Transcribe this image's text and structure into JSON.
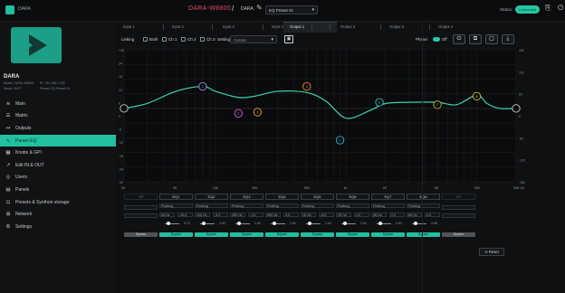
{
  "topbar": {
    "app_name": "DARA",
    "device_title": "DARA-W8800",
    "device_sub": "DARA",
    "preset": "EQ Preset Gr",
    "status_label": "Status:",
    "status_value": "Connected"
  },
  "sidebar": {
    "device_name": "DARA",
    "meta": [
      "Model: DARA-W8800",
      "IP: 192.168.1.100",
      "Serial: 00:F7",
      "Preset: EQ Preset Gr"
    ],
    "items": [
      {
        "icon": "≋",
        "label": "Main"
      },
      {
        "icon": "☰",
        "label": "Matrix"
      },
      {
        "icon": "↦",
        "label": "Outputs"
      },
      {
        "icon": "∿",
        "label": "Param EQ"
      },
      {
        "icon": "▦",
        "label": "Knobs & GPI"
      },
      {
        "icon": "↗",
        "label": "Edit IN & OUT"
      },
      {
        "icon": "◎",
        "label": "Users"
      },
      {
        "icon": "▤",
        "label": "Panels"
      },
      {
        "icon": "⊡",
        "label": "Presets & Synthon storage"
      },
      {
        "icon": "⊞",
        "label": "Network"
      },
      {
        "icon": "⚙",
        "label": "Settings"
      }
    ],
    "active_index": 3
  },
  "tabs": [
    "Input 1",
    "Input 2",
    "Input 3",
    "Input 4",
    "Output 1",
    "Output 2",
    "Output 3",
    "Output 4"
  ],
  "active_tab": 4,
  "toolbar": {
    "linking": "Linking",
    "boxes": [
      "Both",
      "Ch 1",
      "Ch 2",
      "Ch 3"
    ],
    "settings": "Settings",
    "settings_value": "Custom",
    "phase": "Phase:",
    "phase_off": "Off"
  },
  "graph": {
    "y_left": [
      "+18",
      "24",
      "18",
      "12",
      "6",
      "0",
      "-6",
      "-12",
      "-18",
      "-24",
      "-30"
    ],
    "y_right": [
      "180",
      "120",
      "60",
      "0",
      "-60",
      "-120",
      "-180"
    ],
    "x": [
      "20",
      "50",
      "100",
      "200",
      "500",
      "1K",
      "2K",
      "5K",
      "10K",
      "20K Hz"
    ]
  },
  "bands": [
    "HP",
    "EQ1",
    "EQ2",
    "EQ3",
    "EQ4",
    "EQ5",
    "EQ6",
    "EQ7",
    "EQ8",
    "LP"
  ],
  "band_rows": {
    "type": [
      "Peaking",
      "Peaking",
      "Peaking",
      "Peaking",
      "Peaking",
      "Peaking",
      "Peaking",
      "Peaking"
    ],
    "freq": [
      "63 Hz",
      "125 Hz",
      "250 Hz",
      "500 Hz",
      "1K Hz",
      "2K Hz",
      "4K Hz",
      "8K Hz"
    ],
    "gain": [
      "-10.0",
      "-3.0",
      "-1.0",
      "4.0",
      "-8.0",
      "1.0",
      "2.0",
      "4.5"
    ],
    "q": [
      "0.71",
      "1.41",
      "1.41",
      "1.41",
      "1.41",
      "1.41",
      "1.41",
      "2.00"
    ]
  },
  "bypass_label": "Bypass",
  "reset_label": "Reset",
  "colors": {
    "accent": "#22c09f",
    "curve": "#3fd1ad",
    "grid": "#1e2327",
    "bg": "#0e1012"
  },
  "chart_data": {
    "type": "line",
    "x": [
      20,
      30,
      50,
      80,
      100,
      150,
      200,
      300,
      500,
      700,
      1000,
      1500,
      2000,
      3000,
      5000,
      7000,
      10000,
      12000,
      15000,
      20000
    ],
    "y": [
      0,
      2,
      7,
      9,
      7,
      4.5,
      5,
      7,
      6.5,
      3,
      -4,
      -1,
      2,
      2.5,
      2.5,
      1.5,
      5.5,
      2,
      0,
      0
    ],
    "xscale": "log",
    "xlim": [
      20,
      20000
    ],
    "ylim": [
      -30,
      24
    ]
  }
}
